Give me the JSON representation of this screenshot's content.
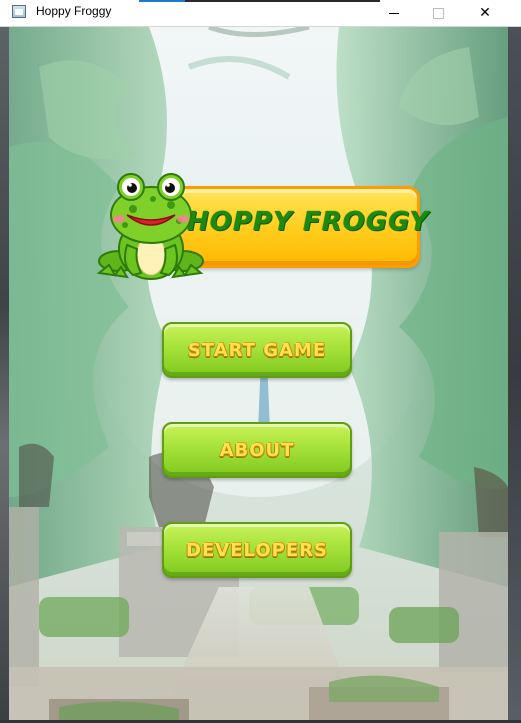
{
  "window": {
    "title": "Hoppy Froggy",
    "minimize_label": "—",
    "close_label": "✕"
  },
  "game": {
    "logo_text": "HOPPY FROGGY",
    "menu": {
      "start_label": "START GAME",
      "about_label": "ABOUT",
      "developers_label": "DEVELOPERS"
    }
  },
  "colors": {
    "button_green": "#a6e23a",
    "button_text": "#ffe24d",
    "logo_plate": "#ffcf1f",
    "logo_text": "#1d8a0c",
    "frog_green": "#6cc51f"
  },
  "icons": {
    "app": "window-app-icon",
    "frog": "frog-mascot-icon"
  }
}
